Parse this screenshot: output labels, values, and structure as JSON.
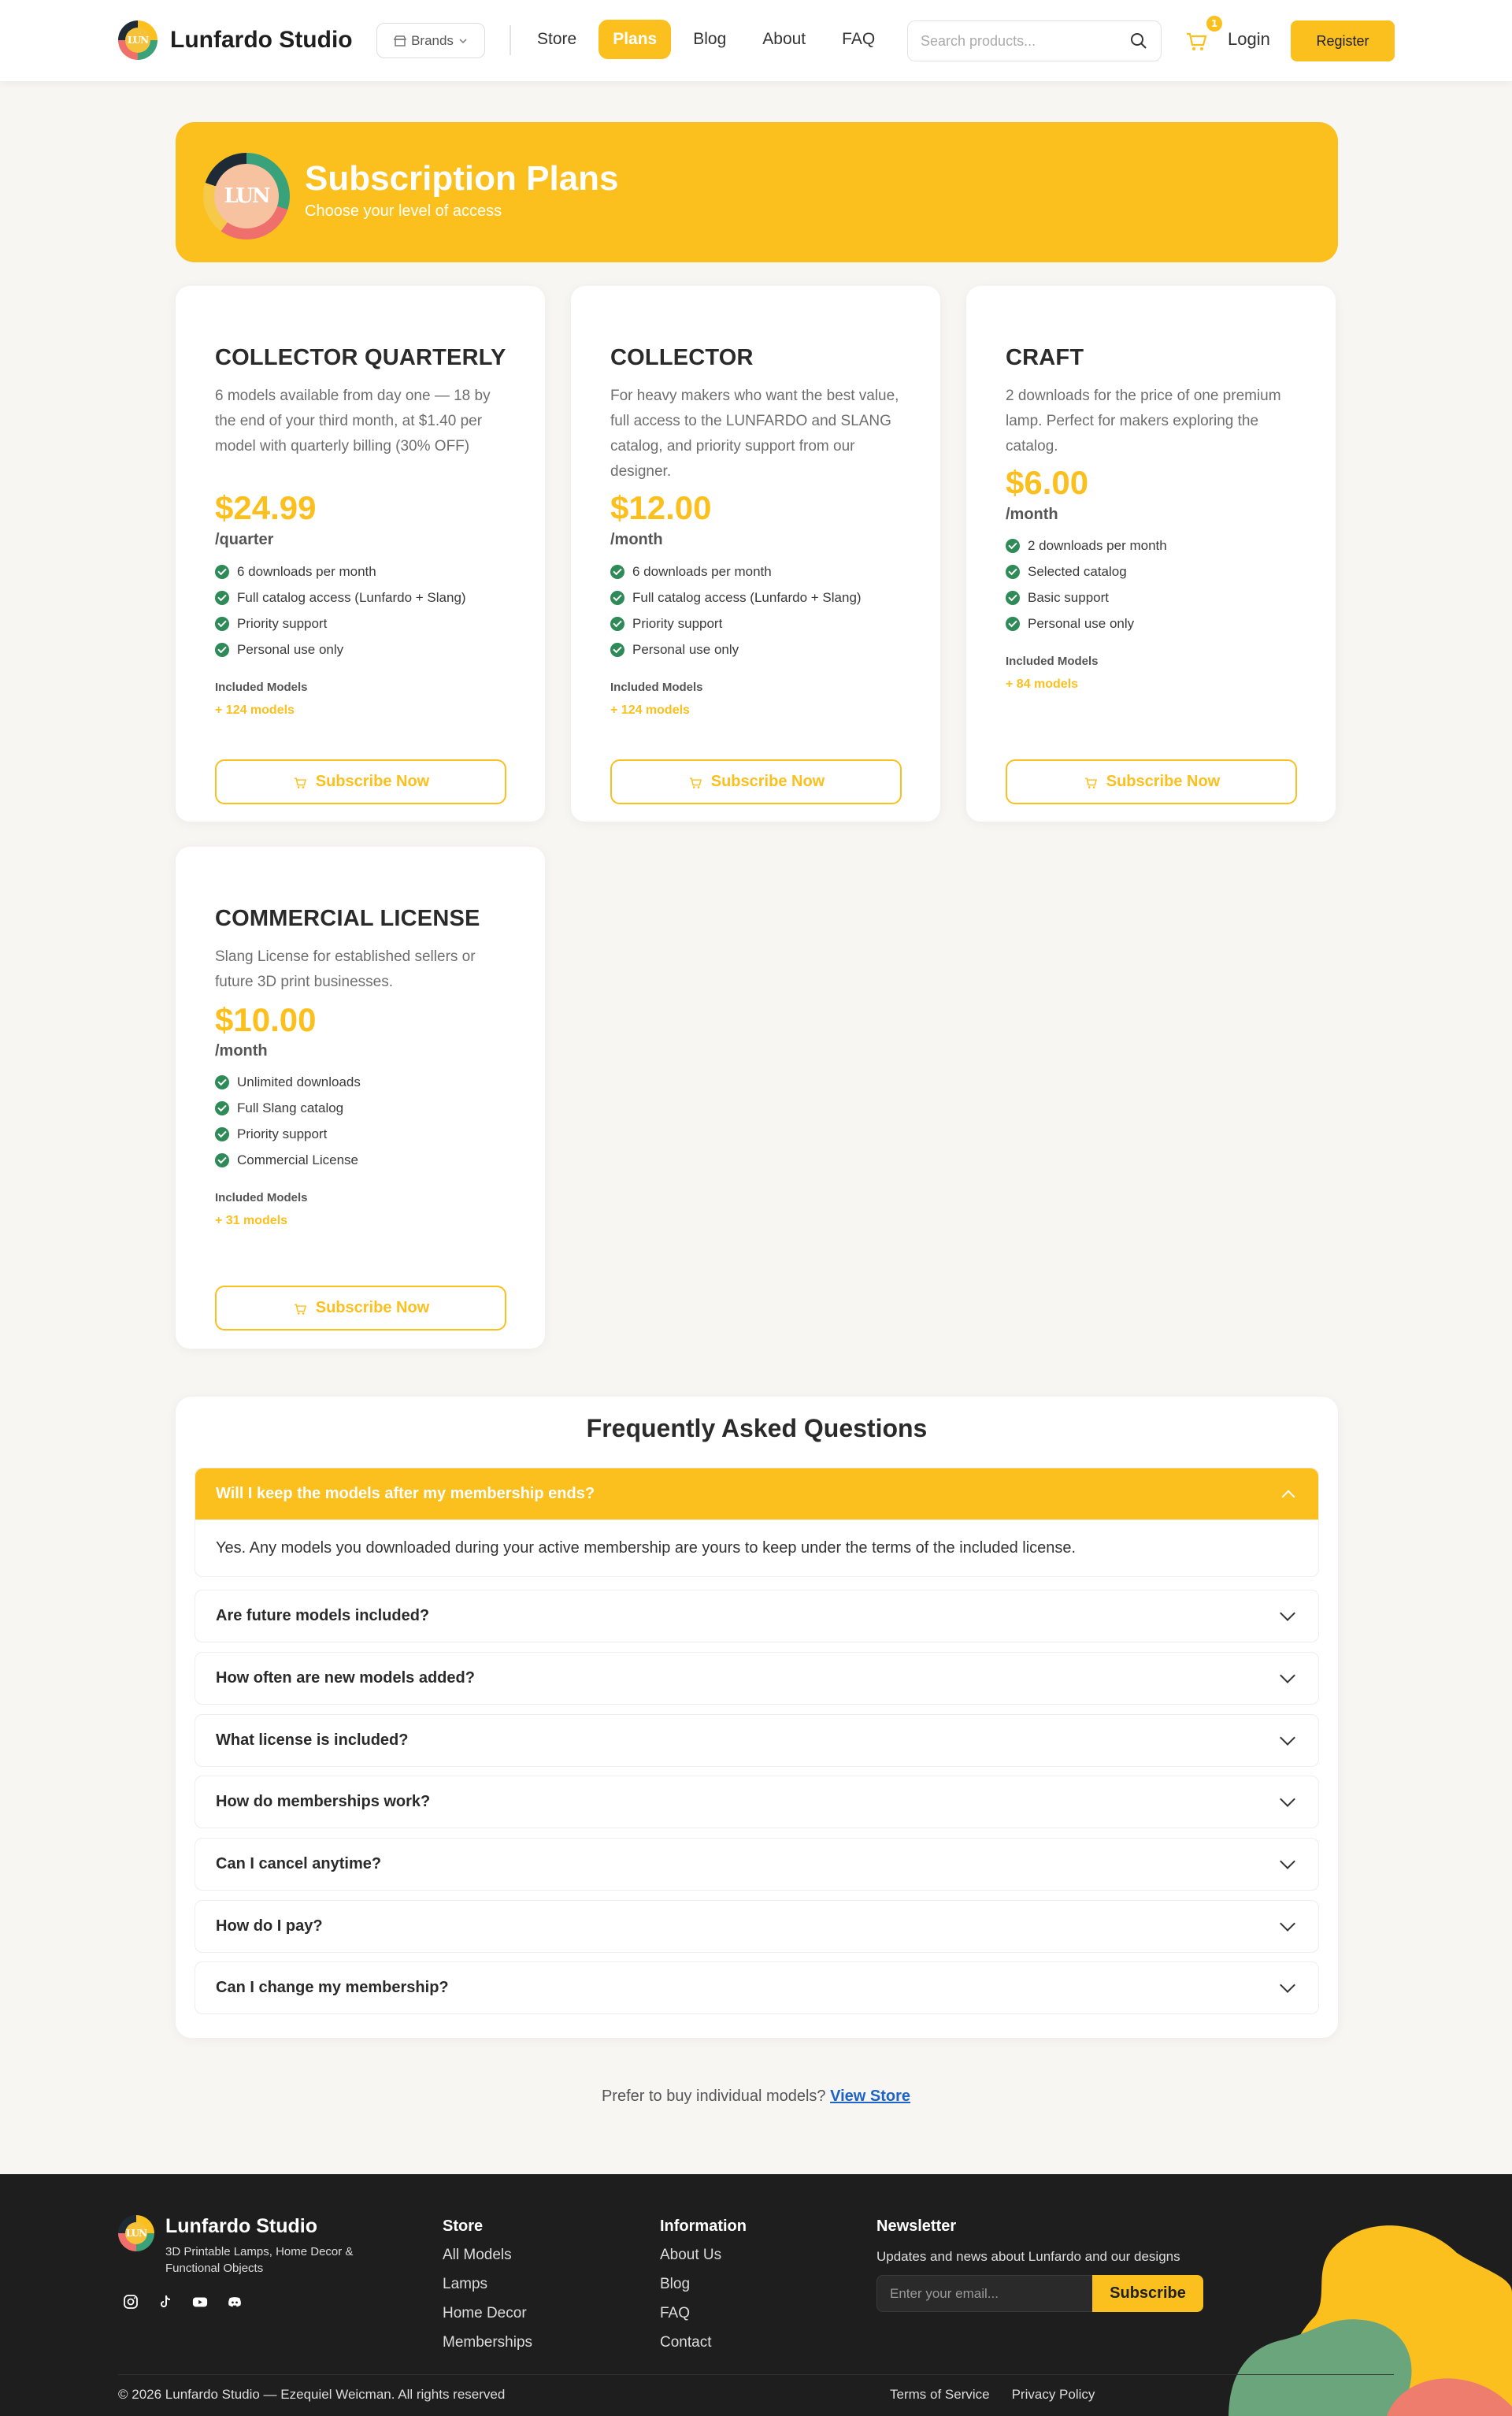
{
  "header": {
    "brand_name": "Lunfardo Studio",
    "brands_label": "Brands",
    "nav": [
      "Store",
      "Plans",
      "Blog",
      "About",
      "FAQ"
    ],
    "active_nav": "Plans",
    "search_placeholder": "Search products...",
    "cart_count": "1",
    "login_label": "Login",
    "register_label": "Register"
  },
  "banner": {
    "title": "Subscription Plans",
    "subtitle": "Choose your level of access"
  },
  "plans": [
    {
      "title": "COLLECTOR QUARTERLY",
      "description": "6 models available from day one — 18 by the end of your third month, at $1.40 per model with quarterly billing (30% OFF)",
      "price": "$24.99",
      "period": "/quarter",
      "features": [
        "6 downloads per month",
        "Full catalog access (Lunfardo + Slang)",
        "Priority support",
        "Personal use only"
      ],
      "included_label": "Included Models",
      "included_count": "+ 124 models",
      "button": "Subscribe Now"
    },
    {
      "title": "COLLECTOR",
      "description": "For heavy makers who want the best value, full access to the LUNFARDO and SLANG catalog, and priority support from our designer.",
      "price": "$12.00",
      "period": "/month",
      "features": [
        "6 downloads per month",
        "Full catalog access (Lunfardo + Slang)",
        "Priority support",
        "Personal use only"
      ],
      "included_label": "Included Models",
      "included_count": "+ 124 models",
      "button": "Subscribe Now"
    },
    {
      "title": "CRAFT",
      "description": "2 downloads for the price of one premium lamp. Perfect for makers exploring the catalog.",
      "price": "$6.00",
      "period": "/month",
      "features": [
        "2 downloads per month",
        "Selected catalog",
        "Basic support",
        "Personal use only"
      ],
      "included_label": "Included Models",
      "included_count": "+ 84 models",
      "button": "Subscribe Now"
    },
    {
      "title": "COMMERCIAL LICENSE",
      "description": "Slang License for established sellers or future 3D print businesses.",
      "price": "$10.00",
      "period": "/month",
      "features": [
        "Unlimited downloads",
        "Full Slang catalog",
        "Priority support",
        "Commercial License"
      ],
      "included_label": "Included Models",
      "included_count": "+ 31 models",
      "button": "Subscribe Now"
    }
  ],
  "faq": {
    "title": "Frequently Asked Questions",
    "items": [
      {
        "q": "Will I keep the models after my membership ends?",
        "a": "Yes. Any models you downloaded during your active membership are yours to keep under the terms of the included license.",
        "open": true
      },
      {
        "q": "Are future models included?"
      },
      {
        "q": "How often are new models added?"
      },
      {
        "q": "What license is included?"
      },
      {
        "q": "How do memberships work?"
      },
      {
        "q": "Can I cancel anytime?"
      },
      {
        "q": "How do I pay?"
      },
      {
        "q": "Can I change my membership?"
      }
    ]
  },
  "prefer": {
    "text": "Prefer to buy individual models?",
    "link": "View Store"
  },
  "footer": {
    "brand_name": "Lunfardo Studio",
    "tagline": "3D Printable Lamps, Home Decor & Functional Objects",
    "socials": [
      "instagram-icon",
      "tiktok-icon",
      "youtube-icon",
      "discord-icon"
    ],
    "store": {
      "title": "Store",
      "links": [
        "All Models",
        "Lamps",
        "Home Decor",
        "Memberships"
      ]
    },
    "information": {
      "title": "Information",
      "links": [
        "About Us",
        "Blog",
        "FAQ",
        "Contact"
      ]
    },
    "newsletter": {
      "title": "Newsletter",
      "text": "Updates and news about Lunfardo and our designs",
      "placeholder": "Enter your email...",
      "button": "Subscribe"
    },
    "copyright": "© 2026 Lunfardo Studio — Ezequiel Weicman. All rights reserved",
    "legal_links": [
      "Terms of Service",
      "Privacy Policy"
    ]
  },
  "colors": {
    "accent": "#fbbf1e",
    "check": "#2e8b57",
    "footer_bg": "#1e1e1e",
    "link": "#1e63c6"
  }
}
